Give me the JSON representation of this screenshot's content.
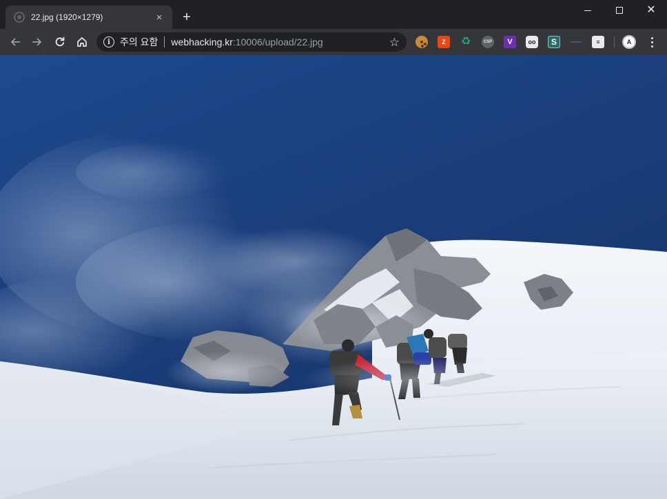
{
  "tab": {
    "title": "22.jpg (1920×1279)",
    "close_glyph": "×",
    "favicon": "globe-icon"
  },
  "new_tab_glyph": "+",
  "window": {
    "close_glyph": "✕"
  },
  "toolbar": {
    "security_label": "주의 요함",
    "url_host": "webhacking.kr",
    "url_rest": ":10006/upload/22.jpg",
    "star_glyph": "☆"
  },
  "extensions": {
    "orange_label": "Z",
    "green_label": "♻",
    "csp_label": "CSP",
    "purple_label": "V",
    "eyes_label": "oo",
    "s_label": "S",
    "ninja_label": "≡"
  },
  "avatar_label": "A",
  "colors": {
    "chrome_dark": "#202124",
    "chrome_toolbar": "#35363a",
    "sky": "#1d4585",
    "snow": "#e6ebf2"
  },
  "image": {
    "subject": "mountaineers-on-snowy-ridge",
    "natural_width": 1920,
    "natural_height": 1279
  }
}
